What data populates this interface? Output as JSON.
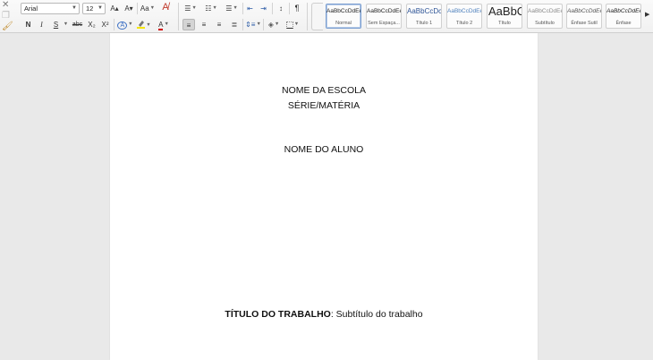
{
  "toolbar": {
    "font_name": "Arial",
    "font_size": "12",
    "grow_font": "A▴",
    "shrink_font": "A▾",
    "change_case": "Aa",
    "bold": "N",
    "italic": "I",
    "underline": "S",
    "strikethrough": "abc",
    "subscript": "X₂",
    "superscript": "X²",
    "text_effects": "A",
    "font_color": "A",
    "pilcrow": "¶"
  },
  "styles": [
    {
      "sample": "AaBbCcDdEe",
      "name": "Normal"
    },
    {
      "sample": "AaBbCcDdEe",
      "name": "Sem Espaça..."
    },
    {
      "sample": "AaBbCcDc",
      "name": "Título 1"
    },
    {
      "sample": "AaBbCcDdEe",
      "name": "Título 2"
    },
    {
      "sample": "AaBbC",
      "name": "Título"
    },
    {
      "sample": "AaBbCcDdEe",
      "name": "Subtítulo"
    },
    {
      "sample": "AaBbCcDdEe",
      "name": "Ênfase Sutil"
    },
    {
      "sample": "AaBbCcDdEe",
      "name": "Ênfase"
    }
  ],
  "document": {
    "school": "NOME DA ESCOLA",
    "grade": "SÉRIE/MATÉRIA",
    "student": "NOME DO ALUNO",
    "work_title": "TÍTULO DO TRABALHO",
    "separator": ":",
    "work_subtitle": " Subtítulo do trabalho"
  },
  "colors": {
    "highlight": "#f5e500",
    "font_color_bar": "#d20000",
    "title1": "#2f5597",
    "title2": "#4f81bd"
  }
}
